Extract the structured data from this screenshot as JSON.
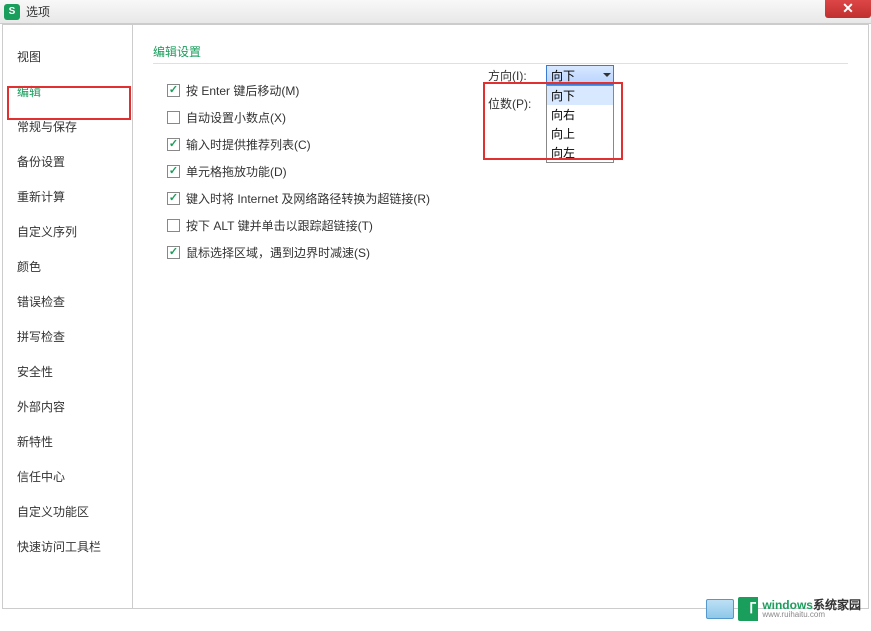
{
  "titlebar": {
    "app_icon_letter": "S",
    "title": "选项"
  },
  "sidebar": {
    "items": [
      {
        "label": "视图"
      },
      {
        "label": "编辑",
        "active": true
      },
      {
        "label": "常规与保存"
      },
      {
        "label": "备份设置"
      },
      {
        "label": "重新计算"
      },
      {
        "label": "自定义序列"
      },
      {
        "label": "颜色"
      },
      {
        "label": "错误检查"
      },
      {
        "label": "拼写检查"
      },
      {
        "label": "安全性"
      },
      {
        "label": "外部内容"
      },
      {
        "label": "新特性"
      },
      {
        "label": "信任中心"
      },
      {
        "label": "自定义功能区"
      },
      {
        "label": "快速访问工具栏"
      }
    ]
  },
  "content": {
    "section_title": "编辑设置",
    "options": [
      {
        "checked": true,
        "label": "按 Enter 键后移动(M)"
      },
      {
        "checked": false,
        "label": "自动设置小数点(X)"
      },
      {
        "checked": true,
        "label": "输入时提供推荐列表(C)"
      },
      {
        "checked": true,
        "label": "单元格拖放功能(D)"
      },
      {
        "checked": true,
        "label": "键入时将 Internet 及网络路径转换为超链接(R)"
      },
      {
        "checked": false,
        "label": "按下 ALT 键并单击以跟踪超链接(T)"
      },
      {
        "checked": true,
        "label": "鼠标选择区域，遇到边界时减速(S)"
      }
    ],
    "controls": {
      "direction": {
        "label": "方向(I):",
        "value": "向下",
        "options": [
          "向下",
          "向右",
          "向上",
          "向左"
        ]
      },
      "digits": {
        "label": "位数(P):"
      }
    }
  },
  "watermark": {
    "brand_green": "windows",
    "brand_dark": "系统家园",
    "url": "www.ruihaitu.com"
  }
}
